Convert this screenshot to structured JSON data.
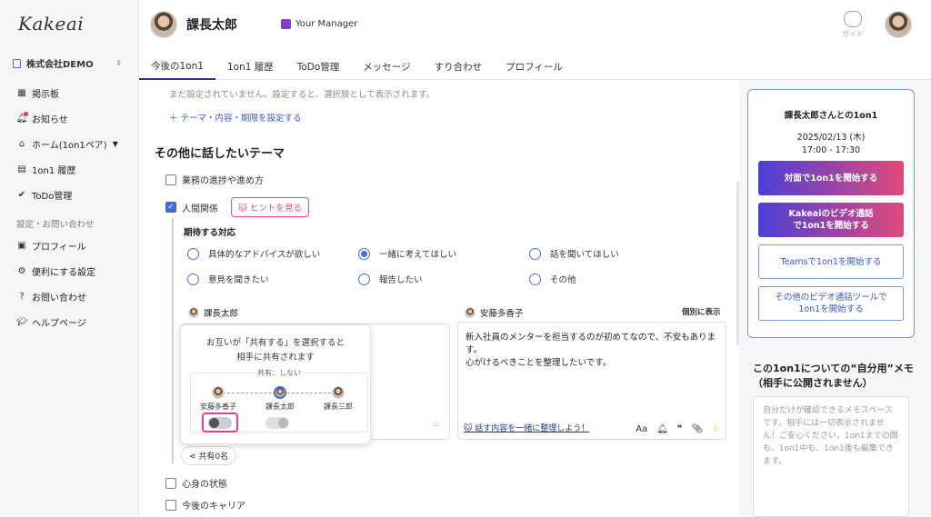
{
  "app": {
    "logo": "Kakeai",
    "company": "株式会社DEMO"
  },
  "sidebar": {
    "items": [
      {
        "label": "掲示板",
        "icon": "board-icon"
      },
      {
        "label": "お知らせ",
        "icon": "bell-icon"
      },
      {
        "label": "ホーム(1on1ペア)",
        "icon": "home-icon"
      },
      {
        "label": "1on1 履歴",
        "icon": "history-icon"
      },
      {
        "label": "ToDo管理",
        "icon": "check-icon"
      }
    ],
    "section": "設定・お問い合わせ",
    "settings": [
      {
        "label": "プロフィール",
        "icon": "profile-icon"
      },
      {
        "label": "便利にする設定",
        "icon": "gear-icon"
      },
      {
        "label": "お問い合わせ",
        "icon": "help-icon"
      },
      {
        "label": "ヘルプページ",
        "icon": "graduation-icon"
      }
    ]
  },
  "header": {
    "user_name": "課長太郎",
    "manager_badge": "Your Manager",
    "guide": "ガイド",
    "tabs": [
      "今後の1on1",
      "1on1 履歴",
      "ToDo管理",
      "メッセージ",
      "すり合わせ",
      "プロフィール"
    ]
  },
  "main": {
    "note": "まだ設定されていません。設定すると、選択肢として表示されます。",
    "set_link": "＋ テーマ・内容・期限を設定する",
    "heading": "その他に話したいテーマ",
    "topics": [
      {
        "label": "業務の進捗や進め方",
        "checked": false
      },
      {
        "label": "人間関係",
        "checked": true
      },
      {
        "label": "心身の状態",
        "checked": false
      },
      {
        "label": "今後のキャリア",
        "checked": false
      }
    ],
    "hint": "ヒントを見る",
    "expect_title": "期待する対応",
    "options": [
      "具体的なアドバイスが欲しい",
      "一緒に考えてほしい",
      "話を聞いてほしい",
      "意見を聞きたい",
      "報告したい",
      "その他"
    ],
    "selected_option": "一緒に考えてほしい",
    "left_card": {
      "name": "課長太郎"
    },
    "right_card": {
      "name": "安藤多香子",
      "toggle_label": "個別に表示",
      "text": [
        "新入社員のメンターを担当するのが初めてなので、不安もあります。",
        "心がけるべきことを整理したいです。"
      ],
      "assist": "話す内容を一緒に整理しよう！"
    },
    "tooltip": {
      "line1": "お互いが「共有する」を選択すると",
      "line2": "相手に共有されます",
      "share_label": "共有：しない",
      "nodes": [
        "安藤多香子",
        "課長太郎",
        "課長三郎"
      ]
    },
    "share_button": "共有0名"
  },
  "right": {
    "title": "課長太郎さんとの1on1",
    "date": "2025/02/13 (木)",
    "time": "17:00 - 17:30",
    "buttons": [
      "対面で1on1を開始する",
      "Kakeaiのビデオ通話で1on1を開始する",
      "Teamsで1on1を開始する",
      "その他のビデオ通話ツールで1on1を開始する"
    ],
    "memo_title": "この1on1についての“自分用”メモ（相手に公開されません）",
    "memo_placeholder": "自分だけが確認できるメモスペースです。相手には一切表示されません！ご安心ください。1on1までの間も、1on1中も、1on1後も編集できます。"
  }
}
